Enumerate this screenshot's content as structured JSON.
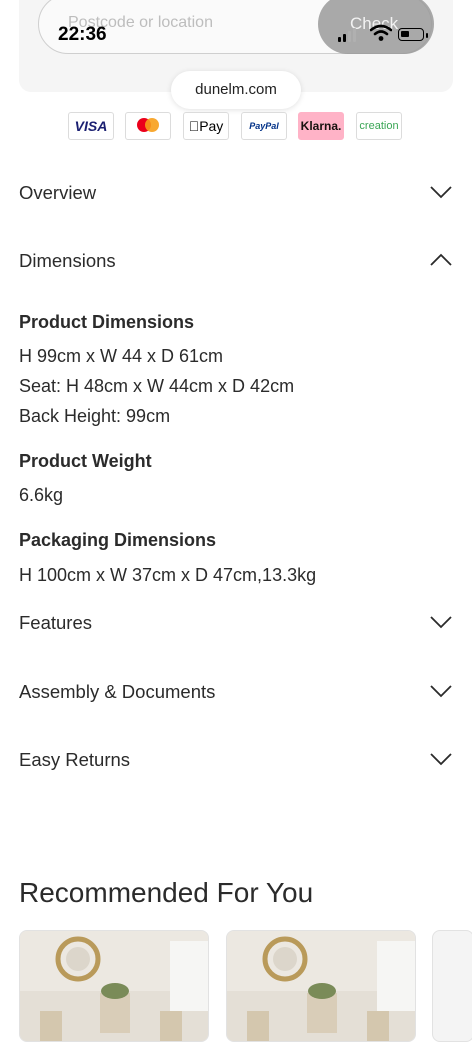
{
  "delivery": {
    "placeholder": "Postcode or location",
    "check_label": "Check"
  },
  "status_bar": {
    "time": "22:36"
  },
  "browser": {
    "url": "dunelm.com"
  },
  "payments": {
    "visa": "VISA",
    "mastercard": "mastercard",
    "apple_pay": "Pay",
    "paypal": "PayPal",
    "klarna": "Klarna.",
    "creation": "creation"
  },
  "accordion": {
    "overview": "Overview",
    "dimensions": "Dimensions",
    "features": "Features",
    "assembly": "Assembly & Documents",
    "returns": "Easy Returns"
  },
  "dimensions": {
    "product_heading": "Product Dimensions",
    "product_lines": [
      "H 99cm x W 44 x D 61cm",
      "Seat: H 48cm x W 44cm x D 42cm",
      "Back Height: 99cm"
    ],
    "weight_heading": "Product Weight",
    "weight_value": "6.6kg",
    "packaging_heading": "Packaging Dimensions",
    "packaging_value": "H 100cm x W 37cm x D 47cm,13.3kg"
  },
  "recommended": {
    "title": "Recommended For You"
  },
  "colors": {
    "text": "#2b2b2b",
    "klarna_pink": "#ffb3c7",
    "creation_green": "#3aa655",
    "paypal_blue": "#003087"
  }
}
